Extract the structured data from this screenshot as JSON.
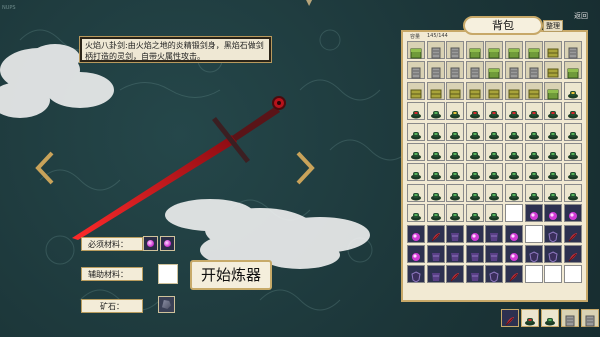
{
  "corner_label": "NUPS",
  "item_description": "火焰八卦剑:由火焰之地的炎精锻剑身，黑焰石做剑柄打造的灵剑，自带火属性攻击。",
  "materials": {
    "required_label": "必须材料：",
    "auxiliary_label": "辅助材料：",
    "ore_label": "矿石："
  },
  "start_button": "开始炼器",
  "backpack": {
    "title": "背包",
    "sort_label": "整理",
    "return_label": "返回",
    "capacity_label": "容量",
    "capacity_value": "145/144"
  },
  "colors": {
    "panel_bg": "#f2ead3",
    "border_gold": "#c7a868",
    "sword_red": "#c8141c"
  },
  "grid": {
    "columns": 9,
    "rows": 12,
    "rows_items": [
      [
        "green-box",
        "gray-scroll",
        "gray-scroll",
        "green-box",
        "green-box",
        "green-box",
        "green-box",
        "olive-brick",
        "gray-scroll"
      ],
      [
        "gray-scroll",
        "gray-scroll",
        "gray-scroll",
        "gray-scroll",
        "green-box",
        "gray-scroll",
        "gray-scroll",
        "olive-brick",
        "green-box"
      ],
      [
        "olive-brick",
        "olive-brick",
        "olive-brick",
        "olive-brick",
        "olive-brick",
        "olive-brick",
        "olive-brick",
        "green-box",
        "yellow-hat"
      ],
      [
        "red-hat",
        "green-hat",
        "yellow-hat",
        "red-hat",
        "red-hat",
        "red-hat",
        "red-hat",
        "red-hat",
        "red-hat"
      ],
      [
        "green-hat",
        "green-hat",
        "green-hat",
        "green-hat",
        "green-hat",
        "green-hat",
        "green-hat",
        "green-hat",
        "green-hat"
      ],
      [
        "green-hat",
        "green-hat",
        "green-hat",
        "green-hat",
        "green-hat",
        "green-hat",
        "green-hat",
        "green-hat",
        "green-hat"
      ],
      [
        "green-hat",
        "green-hat",
        "green-hat",
        "green-hat",
        "green-hat",
        "green-hat",
        "green-hat",
        "green-hat",
        "green-hat"
      ],
      [
        "green-hat",
        "green-hat",
        "green-hat",
        "green-hat",
        "green-hat",
        "green-hat",
        "green-hat",
        "green-hat",
        "green-hat"
      ],
      [
        "green-hat",
        "green-hat",
        "green-hat",
        "green-hat",
        "green-hat",
        "empty",
        "pink-gem",
        "pink-gem",
        "pink-gem"
      ],
      [
        "pink-gem",
        "red-feather",
        "purple-cloth",
        "pink-gem",
        "purple-cloth",
        "pink-gem",
        "empty",
        "purple-shield",
        "red-feather"
      ],
      [
        "pink-gem",
        "purple-cloth",
        "purple-cloth",
        "purple-cloth",
        "purple-cloth",
        "pink-gem",
        "purple-shield",
        "purple-shield",
        "red-feather"
      ],
      [
        "purple-shield",
        "purple-cloth",
        "red-feather",
        "purple-cloth",
        "purple-shield",
        "red-feather",
        "empty",
        "empty",
        "empty"
      ]
    ],
    "quickbar": [
      "red-feather",
      "red-hat",
      "green-hat",
      "gray-scroll",
      "gray-scroll"
    ]
  }
}
